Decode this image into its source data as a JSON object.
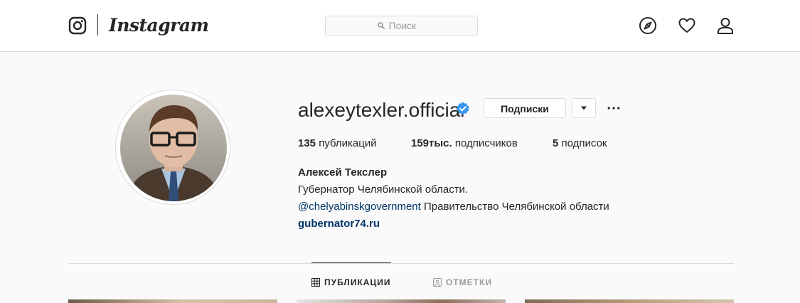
{
  "header": {
    "brand": "Instagram",
    "search": {
      "placeholder": "Поиск",
      "value": ""
    },
    "nav_icons": [
      "explore-icon",
      "activity-heart-icon",
      "profile-icon"
    ]
  },
  "profile": {
    "username": "alexeytexler.official",
    "verified": true,
    "following_button": "Подписки",
    "stats": {
      "posts_count": "135",
      "posts_label": "публикаций",
      "followers_count": "159тыс.",
      "followers_label": "подписчиков",
      "following_count": "5",
      "following_label": "подписок"
    },
    "full_name": "Алексей Текслер",
    "bio_line1": "Губернатор Челябинской области.",
    "bio_mention": "@chelyabinskgovernment",
    "bio_line2_rest": "Правительство Челябинской области",
    "website": "gubernator74.ru"
  },
  "tabs": [
    {
      "label": "ПУБЛИКАЦИИ",
      "active": true,
      "icon": "grid-icon"
    },
    {
      "label": "ОТМЕТКИ",
      "active": false,
      "icon": "tagged-icon"
    }
  ],
  "colors": {
    "background": "#fafafa",
    "border": "#dbdbdb",
    "text": "#262626",
    "muted": "#999999",
    "link": "#003569",
    "verified": "#3897f0"
  }
}
